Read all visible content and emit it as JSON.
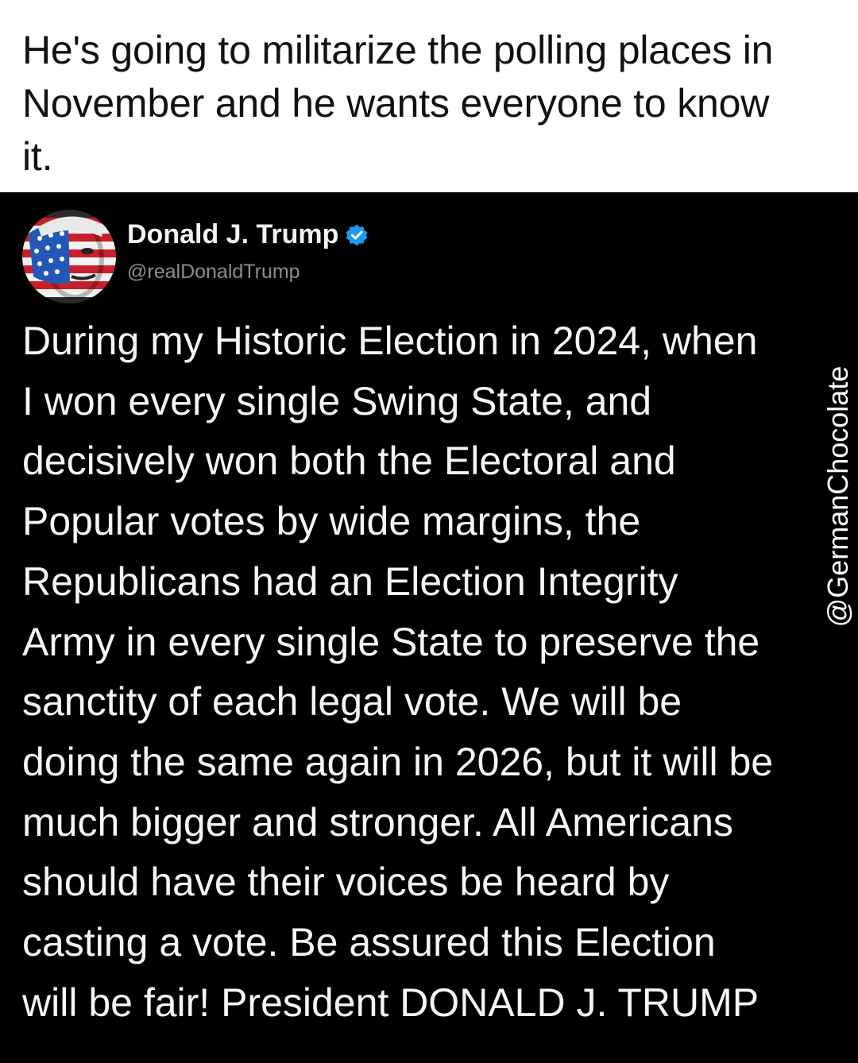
{
  "caption": {
    "lines": [
      "He's going to militarize the polling places in",
      "November and he wants everyone to know",
      "it."
    ]
  },
  "post": {
    "display_name": "Donald J. Trump",
    "handle": "@realDonaldTrump",
    "verified": true,
    "avatar_icon": "flag-painted-face-avatar",
    "accent_color": "#1d9bf0",
    "body_lines": [
      "During my Historic Election in 2024, when",
      "I won every single Swing State, and",
      "decisively won both the Electoral and",
      "Popular votes by wide margins, the",
      "Republicans had an Election Integrity",
      "Army in every single State to preserve the",
      "sanctity of each legal vote. We will be",
      "doing the same again in 2026, but it will be",
      "much bigger and stronger. All Americans",
      "should have their voices be heard by",
      "casting a vote. Be assured this Election",
      "will be fair! President DONALD J. TRUMP"
    ]
  },
  "watermark": {
    "text": "@GermanChocolate"
  }
}
